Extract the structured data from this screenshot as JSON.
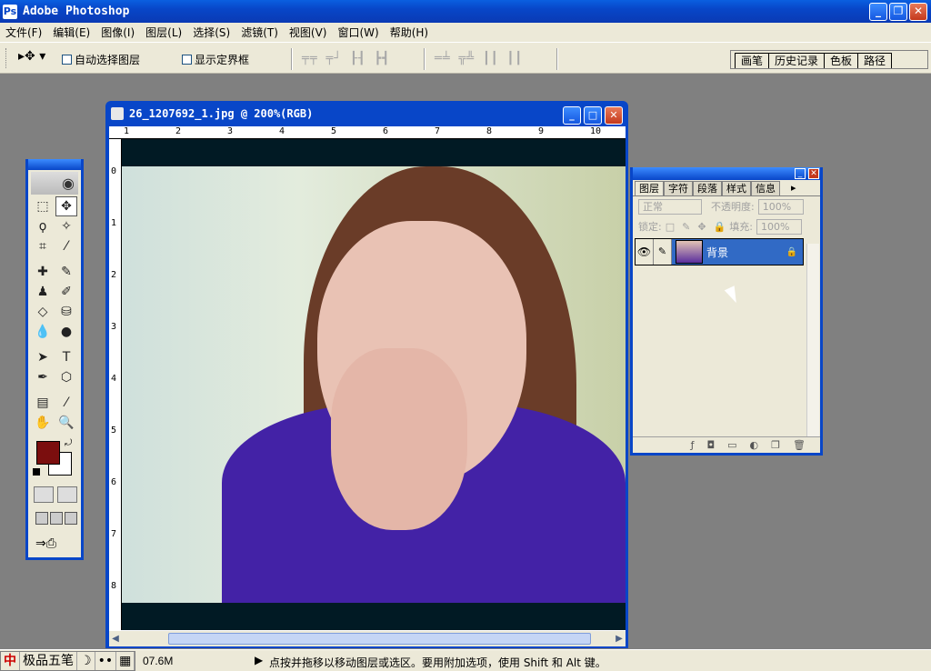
{
  "app": {
    "title": "Adobe Photoshop"
  },
  "menu": [
    "文件(F)",
    "编辑(E)",
    "图像(I)",
    "图层(L)",
    "选择(S)",
    "滤镜(T)",
    "视图(V)",
    "窗口(W)",
    "帮助(H)"
  ],
  "options": {
    "auto_select": "自动选择图层",
    "show_bounds": "显示定界框"
  },
  "palette_well": [
    "画笔",
    "历史记录",
    "色板",
    "路径"
  ],
  "document": {
    "title": "26_1207692_1.jpg @ 200%(RGB)",
    "ruler_h": [
      "1",
      "2",
      "3",
      "4",
      "5",
      "6",
      "7",
      "8",
      "9",
      "10"
    ],
    "ruler_v": [
      "0",
      "1",
      "2",
      "3",
      "4",
      "5",
      "6",
      "7",
      "8"
    ]
  },
  "layers_panel": {
    "tabs": [
      "图层",
      "字符",
      "段落",
      "样式",
      "信息"
    ],
    "blend_mode": "正常",
    "opacity_label": "不透明度:",
    "opacity_value": "100%",
    "lock_label": "锁定:",
    "fill_label": "填充:",
    "fill_value": "100%",
    "layer_name": "背景"
  },
  "colors": {
    "foreground": "#7b0e0e",
    "background": "#ffffff",
    "titlebar": "#0846c8"
  },
  "statusbar": {
    "ime": [
      "中",
      "极品五笔",
      "☽",
      "••",
      "▦"
    ],
    "size": "07.6M",
    "hint": "点按并拖移以移动图层或选区。要用附加选项，使用 Shift 和 Alt 键。"
  }
}
